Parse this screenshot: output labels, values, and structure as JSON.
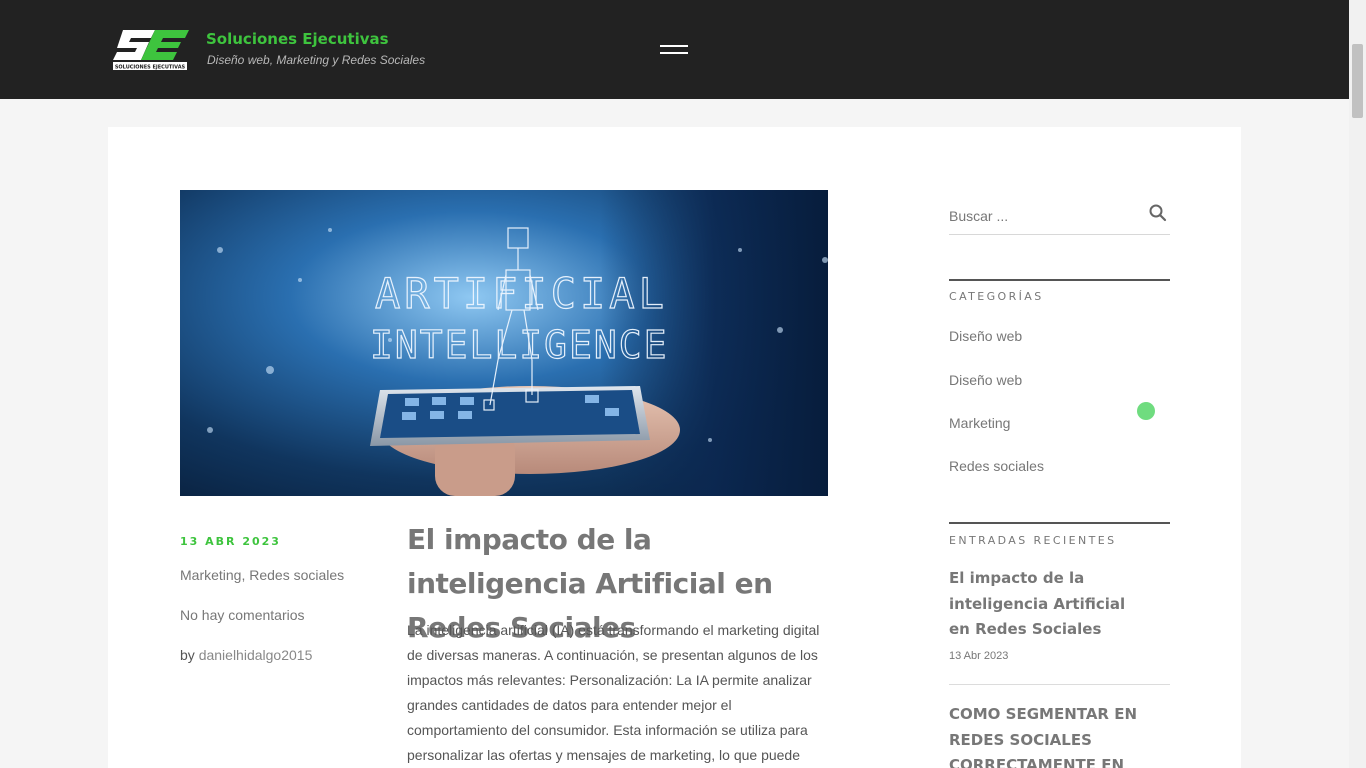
{
  "header": {
    "site_title": "Soluciones Ejecutivas",
    "tagline": "Diseño web, Marketing y Redes Sociales",
    "logo_subtext": "SOLUCIONES EJECUTIVAS"
  },
  "post": {
    "hero_text_line1": "ARTIFICIAL",
    "hero_text_line2": "INTELLIGENCE",
    "date": "13 ABR 2023",
    "categories": "Marketing, Redes sociales",
    "comments": "No hay comentarios",
    "by": "by ",
    "author": "danielhidalgo2015",
    "title": "El impacto de la inteligencia Artificial en Redes Sociales",
    "excerpt": "La inteligencia artificial (IA) está transformando el marketing digital de diversas maneras. A continuación, se presentan algunos de los impactos más relevantes: Personalización: La IA permite analizar grandes cantidades de datos para entender mejor el comportamiento del consumidor. Esta información se utiliza para personalizar las ofertas y mensajes de marketing, lo que puede"
  },
  "sidebar": {
    "search_placeholder": "Buscar ...",
    "categories_title": "CATEGORÍAS",
    "categories": [
      "Diseño web",
      "Diseño web",
      "Marketing",
      "Redes sociales"
    ],
    "recent_title": "ENTRADAS RECIENTES",
    "recent": [
      {
        "title": "El impacto de la inteligencia Artificial en Redes Sociales",
        "date": "13 Abr 2023"
      },
      {
        "title": "COMO SEGMENTAR EN REDES SOCIALES CORRECTAMENTE EN"
      }
    ]
  },
  "colors": {
    "accent": "#3ec43e",
    "header_bg": "#222222",
    "page_bg": "#f5f5f5"
  }
}
